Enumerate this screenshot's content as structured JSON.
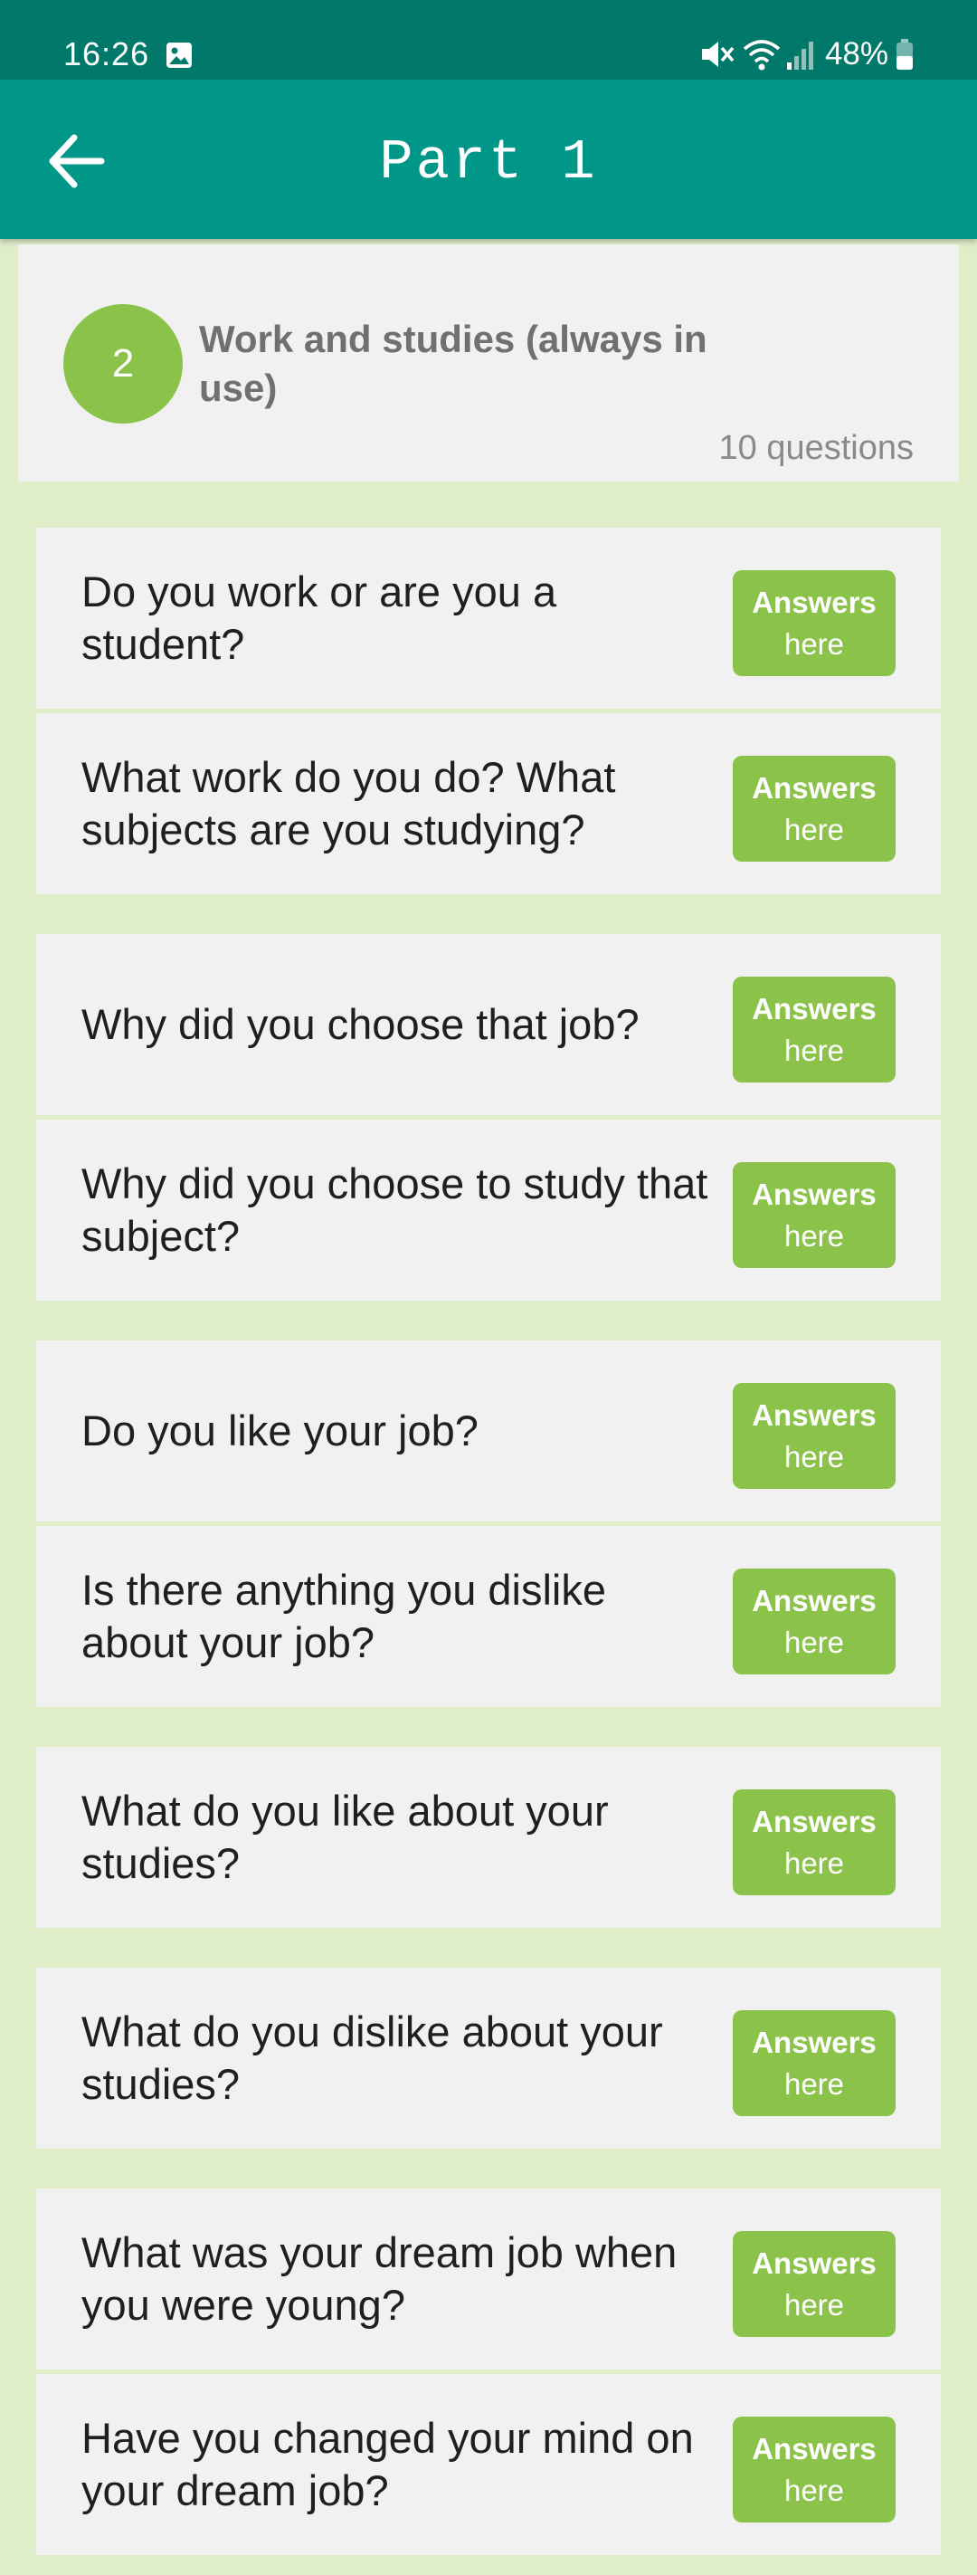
{
  "status_bar": {
    "time": "16:26",
    "battery": "48%",
    "icons": [
      "gallery-icon",
      "mute-icon",
      "wifi-icon",
      "signal-icon",
      "battery-icon"
    ]
  },
  "app_bar": {
    "title": "Part 1",
    "back_icon": "arrow-left-icon"
  },
  "topic": {
    "number": "2",
    "title": "Work and studies (always in use)",
    "count": "10 questions"
  },
  "colors": {
    "status_bar": "#00796b",
    "app_bar": "#009688",
    "accent_green": "#8bc34a",
    "page_background": "#dfedc9",
    "card_background": "#f1f1f1"
  },
  "answer_button": {
    "line1": "Answers",
    "line2": "here"
  },
  "groups": [
    {
      "questions": [
        {
          "text": "Do you work or are you a student?"
        },
        {
          "text": "What work do you do? What subjects are you studying?"
        }
      ]
    },
    {
      "questions": [
        {
          "text": "Why did you choose that job?"
        },
        {
          "text": "Why did you choose to study that subject?"
        }
      ]
    },
    {
      "questions": [
        {
          "text": "Do you like your job?"
        },
        {
          "text": "Is there anything you dislike about your job?"
        }
      ]
    },
    {
      "questions": [
        {
          "text": "What do you like about your studies?"
        }
      ]
    },
    {
      "questions": [
        {
          "text": "What do you dislike about your studies?"
        }
      ]
    },
    {
      "questions": [
        {
          "text": "What was your dream job when you were young?"
        },
        {
          "text": "Have you changed your mind on your dream job?"
        }
      ]
    }
  ]
}
